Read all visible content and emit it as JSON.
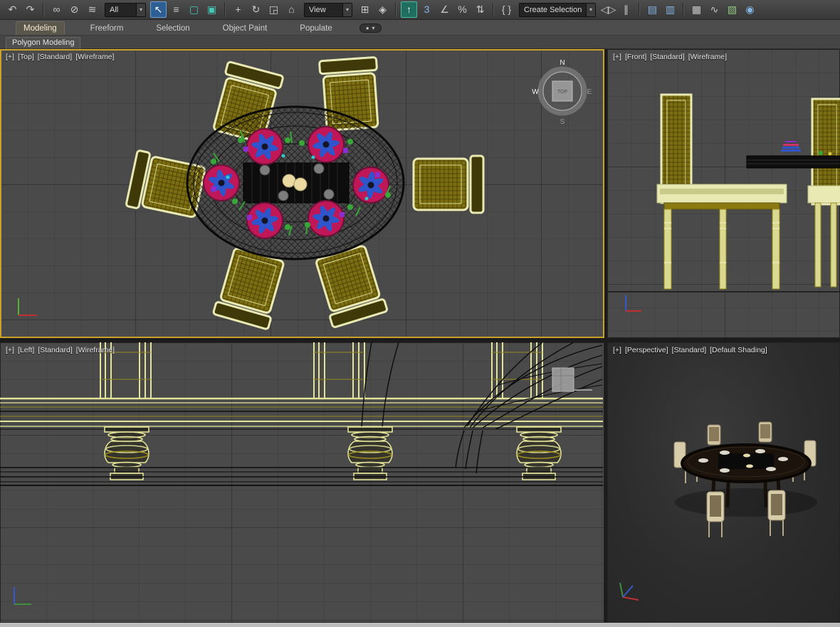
{
  "toolbar": {
    "dropdown_arrow": "▾",
    "items": [
      {
        "type": "icon",
        "name": "undo-icon",
        "glyph": "↶"
      },
      {
        "type": "icon",
        "name": "redo-icon",
        "glyph": "↷"
      },
      {
        "type": "sep"
      },
      {
        "type": "icon",
        "name": "select-and-link-icon",
        "glyph": "∞"
      },
      {
        "type": "icon",
        "name": "unlink-selection-icon",
        "glyph": "⊘"
      },
      {
        "type": "icon",
        "name": "bind-to-space-warp-icon",
        "glyph": "≋"
      },
      {
        "type": "dropdown",
        "name": "selection-filter-dropdown",
        "label": "All"
      },
      {
        "type": "icon",
        "name": "select-object-icon",
        "glyph": "↖",
        "state": "active"
      },
      {
        "type": "icon",
        "name": "select-by-name-icon",
        "glyph": "≡"
      },
      {
        "type": "icon",
        "name": "rectangular-selection-region-icon",
        "glyph": "▢",
        "tint": "teal"
      },
      {
        "type": "icon",
        "name": "window-crossing-icon",
        "glyph": "▣",
        "tint": "teal"
      },
      {
        "type": "sep"
      },
      {
        "type": "icon",
        "name": "select-and-move-icon",
        "glyph": "+"
      },
      {
        "type": "icon",
        "name": "select-and-rotate-icon",
        "glyph": "↻"
      },
      {
        "type": "icon",
        "name": "select-and-scale-icon",
        "glyph": "◲"
      },
      {
        "type": "icon",
        "name": "select-and-place-icon",
        "glyph": "⌂"
      },
      {
        "type": "dropdown",
        "name": "reference-coordinate-system-dropdown",
        "label": "View"
      },
      {
        "type": "icon",
        "name": "use-pivot-point-center-icon",
        "glyph": "⊞"
      },
      {
        "type": "icon",
        "name": "select-and-manipulate-icon",
        "glyph": "◈"
      },
      {
        "type": "sep"
      },
      {
        "type": "icon",
        "name": "keyboard-shortcut-override-icon",
        "glyph": "↑",
        "state": "toggled"
      },
      {
        "type": "icon",
        "name": "snaps-toggle-3d-icon",
        "glyph": "3",
        "tint": "blue"
      },
      {
        "type": "icon",
        "name": "angle-snap-toggle-icon",
        "glyph": "∠"
      },
      {
        "type": "icon",
        "name": "percent-snap-toggle-icon",
        "glyph": "%"
      },
      {
        "type": "icon",
        "name": "spinner-snap-toggle-icon",
        "glyph": "⇅"
      },
      {
        "type": "sep"
      },
      {
        "type": "icon",
        "name": "edit-named-selection-sets-icon",
        "glyph": "{ }"
      },
      {
        "type": "dropdown",
        "name": "named-selection-sets-dropdown",
        "label": "Create Selection Se"
      },
      {
        "type": "icon",
        "name": "mirror-icon",
        "glyph": "◁▷"
      },
      {
        "type": "icon",
        "name": "align-icon",
        "glyph": "∥"
      },
      {
        "type": "sep"
      },
      {
        "type": "icon",
        "name": "toggle-scene-explorer-icon",
        "glyph": "▤",
        "tint": "blue"
      },
      {
        "type": "icon",
        "name": "toggle-layer-explorer-icon",
        "glyph": "▥",
        "tint": "blue"
      },
      {
        "type": "sep"
      },
      {
        "type": "icon",
        "name": "toggle-ribbon-icon",
        "glyph": "▦"
      },
      {
        "type": "icon",
        "name": "curve-editor-icon",
        "glyph": "∿"
      },
      {
        "type": "icon",
        "name": "schematic-view-icon",
        "glyph": "▧",
        "tint": "green"
      },
      {
        "type": "icon",
        "name": "material-editor-icon",
        "glyph": "◉",
        "tint": "blue"
      }
    ]
  },
  "ribbon": {
    "tabs": [
      {
        "label": "Modeling",
        "active": true
      },
      {
        "label": "Freeform"
      },
      {
        "label": "Selection"
      },
      {
        "label": "Object Paint"
      },
      {
        "label": "Populate"
      }
    ],
    "overflow": {
      "dot": "●",
      "caret": "▾"
    },
    "panel_label": "Polygon Modeling"
  },
  "viewports": {
    "top_left": {
      "parts": [
        "[+]",
        "[Top]",
        "[Standard]",
        "[Wireframe]"
      ],
      "active": true
    },
    "top_right": {
      "parts": [
        "[+]",
        "[Front]",
        "[Standard]",
        "[Wireframe]"
      ]
    },
    "bottom_left": {
      "parts": [
        "[+]",
        "[Left]",
        "[Standard]",
        "[Wireframe]"
      ]
    },
    "bottom_right": {
      "parts": [
        "[+]",
        "[Perspective]",
        "[Standard]",
        "[Default Shading]"
      ]
    }
  },
  "viewcube": {
    "n": "N",
    "e": "E",
    "s": "S",
    "w": "W",
    "top": "TOP"
  }
}
